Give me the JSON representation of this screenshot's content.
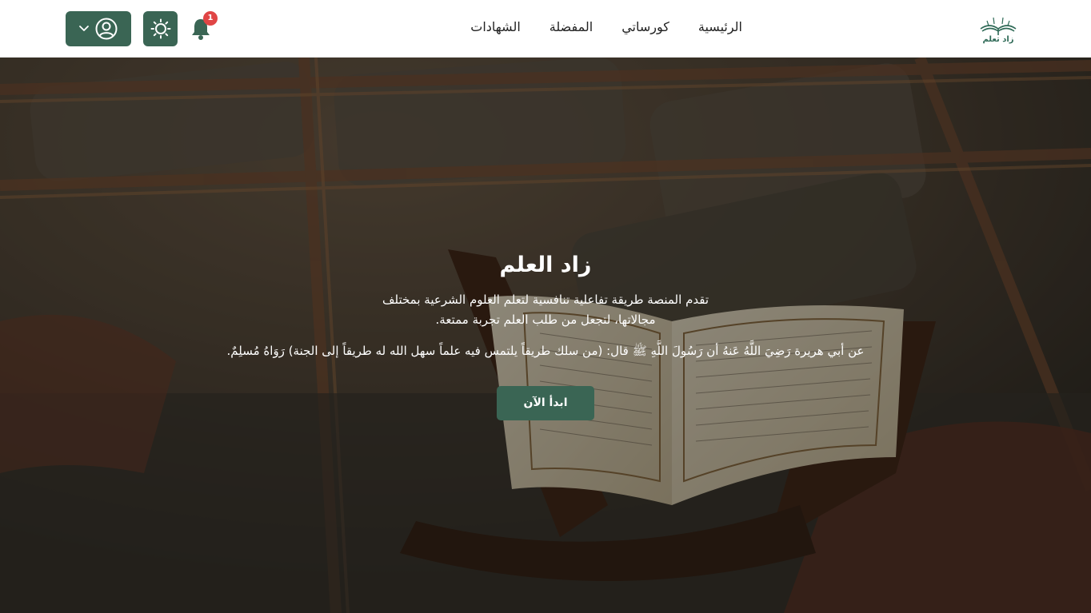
{
  "brand": {
    "name": "زاد تعلم",
    "icon": "open-book-icon",
    "color": "#2f6a57"
  },
  "nav": {
    "links": [
      {
        "label": "الرئيسية"
      },
      {
        "label": "كورساتي"
      },
      {
        "label": "المفضلة"
      },
      {
        "label": "الشهادات"
      }
    ]
  },
  "header_actions": {
    "notification_count": "1",
    "notification_icon": "bell-icon",
    "theme_icon": "sun-icon",
    "user_icon": "user-circle-icon",
    "dropdown_icon": "chevron-down-icon",
    "accent_color": "#3a6554",
    "badge_color": "#e04545"
  },
  "hero": {
    "title": "زاد العلم",
    "description": "تقدم المنصة طريقة تفاعلية تنافسية لتعلم العلوم الشرعية بمختلف مجالاتها، لتجعل من طلب العلم تجربة ممتعة.",
    "hadith": "عن أبي هريرة رَضِيَ اللَّهُ عَنهُ أن رَسُولَ اللَّهِ ﷺ قال: (من سلك طريقاً يلتمس فيه علماً سهل الله له طريقاً إلى الجنة) رَوَاهُ مُسلِمٌ.",
    "cta_label": "ابدأ الآن",
    "background": "quran-on-stand-photo"
  }
}
